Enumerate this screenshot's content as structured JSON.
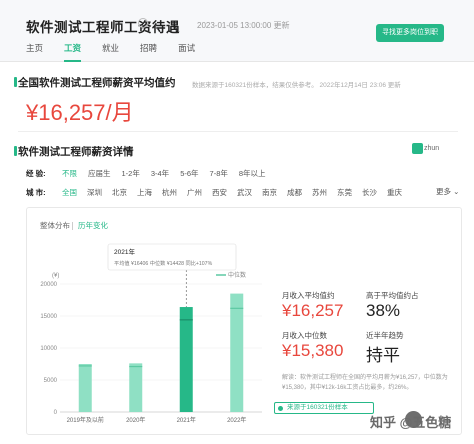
{
  "header": {
    "title": "软件测试工程师工资待遇",
    "update_time": "2023-01-05 13:00:00 更新",
    "find_button": "寻找更多岗位到职",
    "tabs": [
      {
        "label": "主页",
        "active": false
      },
      {
        "label": "工资",
        "active": true
      },
      {
        "label": "就业",
        "active": false
      },
      {
        "label": "招聘",
        "active": false
      },
      {
        "label": "面试",
        "active": false
      }
    ]
  },
  "avg_section": {
    "title": "全国软件测试工程师薪资平均值约",
    "note": "数据来源于160321份样本，结果仅供参考。  2022年12月14日 23:06 更新",
    "salary": "¥16,257/月"
  },
  "detail_section": {
    "title": "软件测试工程师薪资详情",
    "user_badge": "zhun",
    "experience_label": "经  验:",
    "experience_options": [
      {
        "label": "不限",
        "active": true
      },
      {
        "label": "应届生",
        "active": false
      },
      {
        "label": "1-2年",
        "active": false
      },
      {
        "label": "3-4年",
        "active": false
      },
      {
        "label": "5-6年",
        "active": false
      },
      {
        "label": "7-8年",
        "active": false
      },
      {
        "label": "8年以上",
        "active": false
      }
    ],
    "city_label": "城  市:",
    "city_options": [
      {
        "label": "全国",
        "active": true
      },
      {
        "label": "深圳",
        "active": false
      },
      {
        "label": "北京",
        "active": false
      },
      {
        "label": "上海",
        "active": false
      },
      {
        "label": "杭州",
        "active": false
      },
      {
        "label": "广州",
        "active": false
      },
      {
        "label": "西安",
        "active": false
      },
      {
        "label": "武汉",
        "active": false
      },
      {
        "label": "南京",
        "active": false
      },
      {
        "label": "成都",
        "active": false
      },
      {
        "label": "苏州",
        "active": false
      },
      {
        "label": "东莞",
        "active": false
      },
      {
        "label": "长沙",
        "active": false
      },
      {
        "label": "重庆",
        "active": false
      }
    ],
    "more_label": "更多",
    "subtabs": {
      "distribution": "整体分布",
      "trend": "历年变化"
    }
  },
  "chart_data": {
    "type": "bar",
    "unit_label": "(¥)",
    "legend_label": "中位数",
    "categories": [
      "2019年及以前",
      "2020年",
      "2021年",
      "2022年"
    ],
    "series": [
      {
        "name": "平均值",
        "values": [
          7500,
          7600,
          16400,
          18500
        ]
      },
      {
        "name": "中位数",
        "values": [
          7200,
          7100,
          14400,
          16200
        ]
      }
    ],
    "ylim": [
      0,
      20000
    ],
    "yticks": [
      "0",
      "5000",
      "10000",
      "15000",
      "20000"
    ],
    "highlight_index": 2,
    "tooltip": {
      "title": "2021年",
      "line": "平均值 ¥16406  中位数 ¥14428  同比+107%"
    },
    "colors": {
      "bar": "#8fe0c4",
      "highlight": "#26b888",
      "median_line": "#5cc9a2"
    }
  },
  "stats": {
    "avg_label": "月收入平均值约",
    "avg_value": "¥16,257",
    "higher_label": "高于平均值约占",
    "higher_value": "38%",
    "median_label": "月收入中位数",
    "median_value": "¥15,380",
    "trend_label": "近半年趋势",
    "trend_value": "持平",
    "note": "解读：软件测试工程师在全国的平均月薪为¥16,257，中位数为¥15,380，其中¥12k-16k工资占比最多，约26%。",
    "source": "来源于160321份样本"
  },
  "watermark": {
    "text": "知乎 @五色糖"
  },
  "colors": {
    "accent": "#26b888",
    "price": "#e8473d"
  }
}
